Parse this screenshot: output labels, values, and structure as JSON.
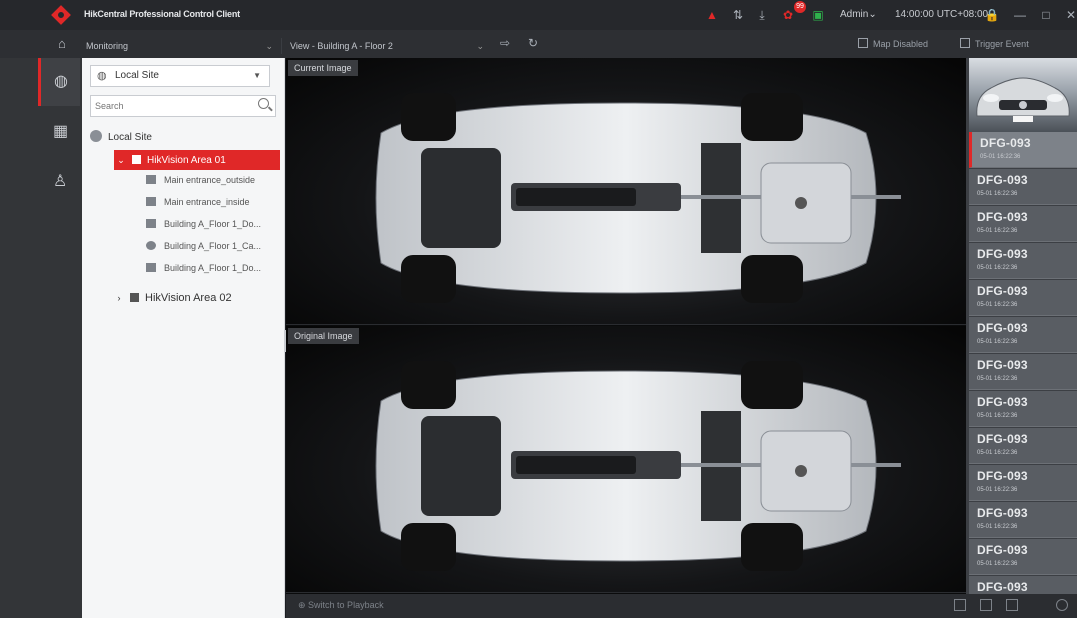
{
  "titlebar": {
    "app_title": "HikCentral Professional Control Client",
    "alarm_badge": "99",
    "user": "Admin",
    "clock": "14:00:00 UTC+08:00",
    "lock_icon": "lock-icon",
    "minimize": "—",
    "maximize": "□",
    "close": "✕"
  },
  "menubar": {
    "module": "Monitoring",
    "view": "View - Building A - Floor 2",
    "map_button": "Map Disabled",
    "trigger_button": "Trigger Event"
  },
  "rail": {
    "items": [
      "globe-icon",
      "grid-icon",
      "person-icon"
    ]
  },
  "resource_panel": {
    "site_select": "Local Site",
    "search_placeholder": "Search",
    "root": "Local Site",
    "area1": {
      "name": "HikVision Area 01",
      "cameras": [
        "Main entrance_outside",
        "Main entrance_inside",
        "Building A_Floor 1_Do...",
        "Building A_Floor 1_Ca...",
        "Building A_Floor 1_Do..."
      ]
    },
    "area2": "HikVision Area 02"
  },
  "image_area": {
    "current_label": "Current Image",
    "original_label": "Original Image"
  },
  "statusbar": {
    "playback": "Switch to Playback"
  },
  "captures": {
    "records": [
      {
        "plate": "DFG-093",
        "time": "05-01 16:22:36"
      },
      {
        "plate": "DFG-093",
        "time": "05-01 16:22:36"
      },
      {
        "plate": "DFG-093",
        "time": "05-01 16:22:36"
      },
      {
        "plate": "DFG-093",
        "time": "05-01 16:22:36"
      },
      {
        "plate": "DFG-093",
        "time": "05-01 16:22:36"
      },
      {
        "plate": "DFG-093",
        "time": "05-01 16:22:36"
      },
      {
        "plate": "DFG-093",
        "time": "05-01 16:22:36"
      },
      {
        "plate": "DFG-093",
        "time": "05-01 16:22:36"
      },
      {
        "plate": "DFG-093",
        "time": "05-01 16:22:36"
      },
      {
        "plate": "DFG-093",
        "time": "05-01 16:22:36"
      },
      {
        "plate": "DFG-093",
        "time": "05-01 16:22:36"
      },
      {
        "plate": "DFG-093",
        "time": "05-01 16:22:36"
      },
      {
        "plate": "DFG-093",
        "time": "05-01 16:22:36"
      }
    ]
  },
  "colors": {
    "accent": "#e02828",
    "titlebar_bg": "#26282c",
    "panel_bg": "#f5f6f7"
  }
}
